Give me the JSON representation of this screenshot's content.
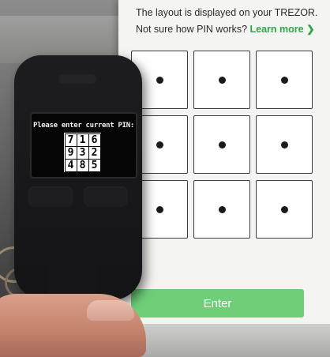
{
  "instruction": {
    "line1": "The layout is displayed on your TREZOR.",
    "line2": "Not sure how PIN works?",
    "learn_more": "Learn more ❯"
  },
  "pin_grid": {
    "cell_count": 9,
    "dot_glyph": "dot"
  },
  "enter_label": "Enter",
  "device": {
    "prompt": "Please enter current PIN:",
    "matrix": [
      "7",
      "1",
      "6",
      "9",
      "3",
      "2",
      "4",
      "8",
      "5"
    ]
  },
  "colors": {
    "accent": "#2fa54a",
    "enter_button": "#6fce78"
  }
}
